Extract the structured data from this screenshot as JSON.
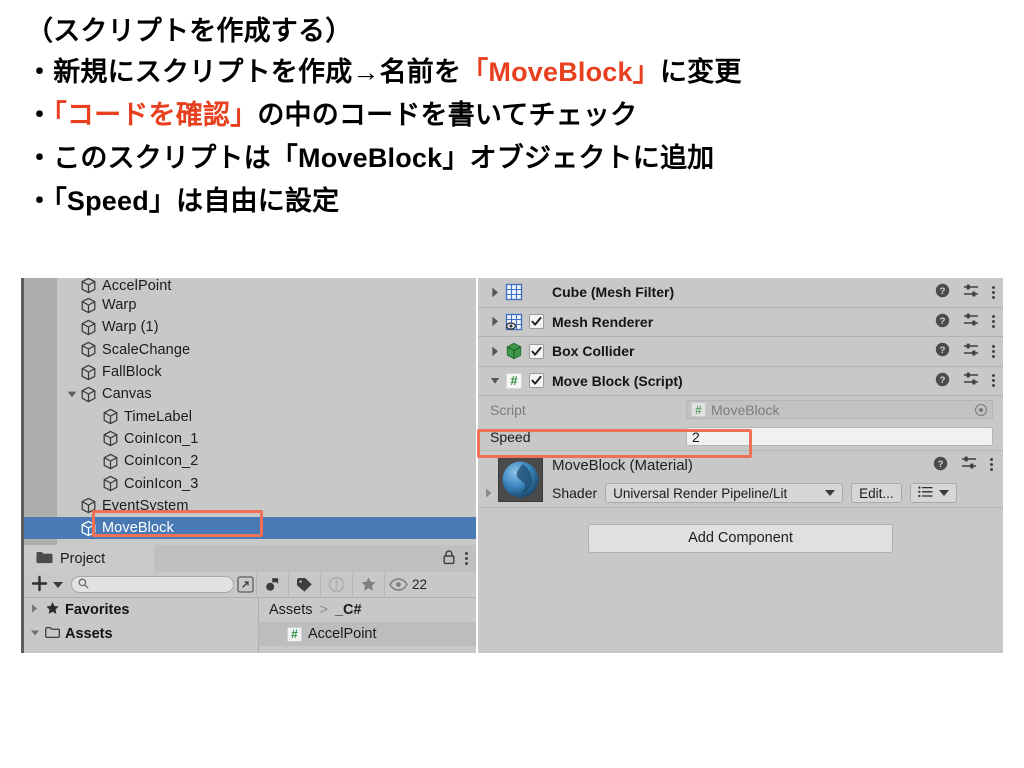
{
  "slide": {
    "lines": [
      {
        "id": "line-0",
        "segments": [
          {
            "t": "（スクリプトを作成する）",
            "hl": false
          }
        ]
      },
      {
        "id": "line-1",
        "segments": [
          {
            "t": "・新規にスクリプトを作成→名前を",
            "hl": false
          },
          {
            "t": "「MoveBlock」",
            "hl": true
          },
          {
            "t": "に変更",
            "hl": false
          }
        ]
      },
      {
        "id": "line-2",
        "segments": [
          {
            "t": "・",
            "hl": false
          },
          {
            "t": "「コードを確認」",
            "hl": true
          },
          {
            "t": "の中のコードを書いてチェック",
            "hl": false
          }
        ]
      },
      {
        "id": "line-3",
        "segments": [
          {
            "t": "・このスクリプトは「MoveBlock」オブジェクトに追加",
            "hl": false
          }
        ]
      },
      {
        "id": "line-4",
        "segments": [
          {
            "t": "・「Speed」は自由に設定",
            "hl": false
          }
        ]
      }
    ],
    "highlight_color": "#e8401f"
  },
  "unity": {
    "hierarchy": {
      "rows": [
        {
          "label": "AccelPoint",
          "indent": 1,
          "arrow": "none",
          "selected": false,
          "clipped": true
        },
        {
          "label": "Warp",
          "indent": 1,
          "arrow": "none",
          "selected": false
        },
        {
          "label": "Warp (1)",
          "indent": 1,
          "arrow": "none",
          "selected": false
        },
        {
          "label": "ScaleChange",
          "indent": 1,
          "arrow": "none",
          "selected": false
        },
        {
          "label": "FallBlock",
          "indent": 1,
          "arrow": "none",
          "selected": false
        },
        {
          "label": "Canvas",
          "indent": 1,
          "arrow": "down",
          "selected": false
        },
        {
          "label": "TimeLabel",
          "indent": 2,
          "arrow": "none",
          "selected": false
        },
        {
          "label": "CoinIcon_1",
          "indent": 2,
          "arrow": "none",
          "selected": false
        },
        {
          "label": "CoinIcon_2",
          "indent": 2,
          "arrow": "none",
          "selected": false
        },
        {
          "label": "CoinIcon_3",
          "indent": 2,
          "arrow": "none",
          "selected": false
        },
        {
          "label": "EventSystem",
          "indent": 1,
          "arrow": "none",
          "selected": false
        },
        {
          "label": "MoveBlock",
          "indent": 1,
          "arrow": "none",
          "selected": true
        }
      ],
      "selection_color": "#4a7ab5",
      "annotation_color": "#ef7054"
    },
    "project": {
      "tab_label": "Project",
      "search_placeholder": "",
      "search_value": "",
      "eye_count": "22",
      "left_tree": [
        {
          "label": "Favorites",
          "icon": "star-icon",
          "arrow": "right"
        },
        {
          "label": "Assets",
          "icon": "folder-icon",
          "arrow": "down",
          "clipped": true
        }
      ],
      "breadcrumb": [
        "Assets",
        "_C#"
      ],
      "breadcrumb_separator": ">",
      "assets": [
        {
          "label": "AccelPoint",
          "badge": "#"
        }
      ]
    },
    "inspector": {
      "components": [
        {
          "title": "Cube (Mesh Filter)",
          "icon": "mesh-filter-icon",
          "arrow": "right",
          "has_checkbox": false,
          "checked": false
        },
        {
          "title": "Mesh Renderer",
          "icon": "mesh-renderer-icon",
          "arrow": "right",
          "has_checkbox": true,
          "checked": true
        },
        {
          "title": "Box Collider",
          "icon": "box-collider-icon",
          "arrow": "right",
          "has_checkbox": true,
          "checked": true
        },
        {
          "title": "Move Block (Script)",
          "icon": "csharp-script-icon",
          "arrow": "down",
          "has_checkbox": true,
          "checked": true
        }
      ],
      "row_icons": {
        "help": "?",
        "preset": "preset-icon",
        "menu": "kebab-icon"
      },
      "script_property": {
        "label": "Script",
        "value": "MoveBlock",
        "badge": "#"
      },
      "speed_property": {
        "label": "Speed",
        "value": "2"
      },
      "material": {
        "title": "MoveBlock (Material)",
        "shader_label": "Shader",
        "shader_value": "Universal Render Pipeline/Lit",
        "edit_label": "Edit..."
      },
      "add_component_label": "Add Component"
    }
  }
}
